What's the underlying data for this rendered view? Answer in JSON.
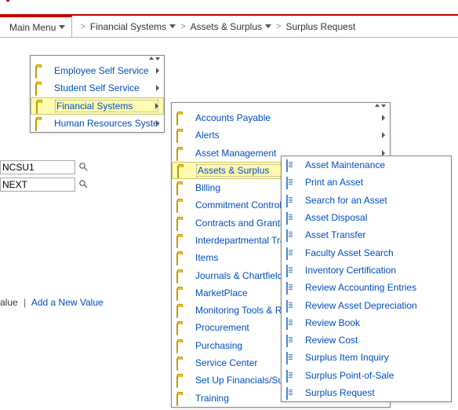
{
  "breadcrumb": {
    "main_menu": "Main Menu",
    "items": [
      {
        "label": "Financial Systems",
        "has_dropdown": true
      },
      {
        "label": "Assets & Surplus",
        "has_dropdown": true
      },
      {
        "label": "Surplus Request",
        "has_dropdown": false
      }
    ]
  },
  "search": {
    "field1_value": "NCSU1",
    "field2_value": "NEXT"
  },
  "linkrow": {
    "part1": "alue",
    "part2": "Add a New Value"
  },
  "menu1": [
    {
      "label": "Employee Self Service",
      "type": "folder",
      "has_sub": true
    },
    {
      "label": "Student Self Service",
      "type": "folder",
      "has_sub": true
    },
    {
      "label": "Financial Systems",
      "type": "folder",
      "has_sub": true,
      "highlight": true
    },
    {
      "label": "Human Resources Systems",
      "type": "folder",
      "has_sub": true
    }
  ],
  "menu2": [
    {
      "label": "Accounts Payable",
      "type": "folder",
      "has_sub": true
    },
    {
      "label": "Alerts",
      "type": "folder",
      "has_sub": true
    },
    {
      "label": "Asset Management",
      "type": "folder",
      "has_sub": true
    },
    {
      "label": "Assets & Surplus",
      "type": "folder",
      "has_sub": true,
      "highlight": true
    },
    {
      "label": "Billing",
      "type": "folder",
      "has_sub": false
    },
    {
      "label": "Commitment Control",
      "type": "folder",
      "has_sub": false
    },
    {
      "label": "Contracts and Grants",
      "type": "folder",
      "has_sub": false
    },
    {
      "label": "Interdepartmental Transfers",
      "type": "folder",
      "has_sub": false
    },
    {
      "label": "Items",
      "type": "folder",
      "has_sub": false
    },
    {
      "label": "Journals & Chartfield Maint",
      "type": "folder",
      "has_sub": false
    },
    {
      "label": "MarketPlace",
      "type": "folder",
      "has_sub": false
    },
    {
      "label": "Monitoring Tools & Reports",
      "type": "folder",
      "has_sub": false
    },
    {
      "label": "Procurement",
      "type": "folder",
      "has_sub": false
    },
    {
      "label": "Purchasing",
      "type": "folder",
      "has_sub": false
    },
    {
      "label": "Service Center",
      "type": "folder",
      "has_sub": false
    },
    {
      "label": "Set Up Financials/Supply",
      "type": "folder",
      "has_sub": false
    },
    {
      "label": "Training",
      "type": "folder",
      "has_sub": false
    }
  ],
  "menu3": [
    {
      "label": "Asset Maintenance",
      "type": "doc"
    },
    {
      "label": "Print an Asset",
      "type": "doc"
    },
    {
      "label": "Search for an Asset",
      "type": "doc"
    },
    {
      "label": "Asset Disposal",
      "type": "doc"
    },
    {
      "label": "Asset Transfer",
      "type": "doc"
    },
    {
      "label": "Faculty Asset Search",
      "type": "doc"
    },
    {
      "label": "Inventory Certification",
      "type": "doc"
    },
    {
      "label": "Review Accounting Entries",
      "type": "doc"
    },
    {
      "label": "Review Asset Depreciation",
      "type": "doc"
    },
    {
      "label": "Review Book",
      "type": "doc"
    },
    {
      "label": "Review Cost",
      "type": "doc"
    },
    {
      "label": "Surplus Item Inquiry",
      "type": "doc"
    },
    {
      "label": "Surplus Point-of-Sale",
      "type": "doc"
    },
    {
      "label": "Surplus Request",
      "type": "doc"
    }
  ]
}
